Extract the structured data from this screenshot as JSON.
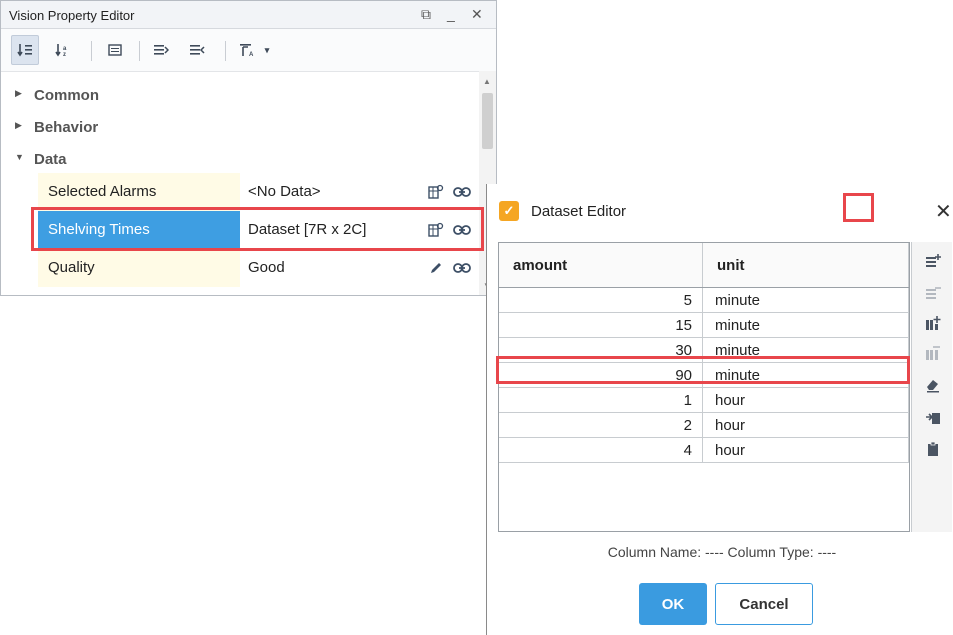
{
  "property_editor": {
    "title": "Vision Property Editor",
    "window_controls": {
      "restore": "⧉",
      "minimize": "_",
      "close": "✕"
    },
    "toolbar": [
      "sort-alpha-icon",
      "sort-category-icon",
      "details-icon",
      "expand-all-icon",
      "collapse-all-icon",
      "filter-icon",
      "dropdown-arrow-icon"
    ],
    "categories": [
      {
        "label": "Common",
        "expanded": false
      },
      {
        "label": "Behavior",
        "expanded": false
      },
      {
        "label": "Data",
        "expanded": true
      }
    ],
    "properties": [
      {
        "name": "Selected Alarms",
        "value": "<No Data>",
        "edit_icon": "dataset-editor-icon",
        "selected": false
      },
      {
        "name": "Shelving Times",
        "value": "Dataset [7R x 2C]",
        "edit_icon": "dataset-editor-icon",
        "selected": true
      },
      {
        "name": "Quality",
        "value": "Good",
        "edit_icon": "pencil-icon",
        "selected": false
      }
    ],
    "highlight_color": "#3e9ee2",
    "name_cell_color": "#fffbe6"
  },
  "dataset_editor": {
    "title": "Dataset Editor",
    "close": "✕",
    "columns": [
      "amount",
      "unit"
    ],
    "rows": [
      [
        "5",
        "minute"
      ],
      [
        "15",
        "minute"
      ],
      [
        "30",
        "minute"
      ],
      [
        "90",
        "minute"
      ],
      [
        "1",
        "hour"
      ],
      [
        "2",
        "hour"
      ],
      [
        "4",
        "hour"
      ]
    ],
    "side_buttons": [
      {
        "icon": "add-row-icon",
        "enabled": true
      },
      {
        "icon": "remove-row-icon",
        "enabled": false
      },
      {
        "icon": "add-column-icon",
        "enabled": true
      },
      {
        "icon": "remove-column-icon",
        "enabled": false
      },
      {
        "icon": "clear-eraser-icon",
        "enabled": true
      },
      {
        "icon": "import-icon",
        "enabled": true
      },
      {
        "icon": "clipboard-icon",
        "enabled": true
      }
    ],
    "info": "Column Name: ----   Column Type: ----",
    "ok_label": "OK",
    "cancel_label": "Cancel",
    "accent_color": "#3a9be0"
  },
  "annotation_color": "#e8464b"
}
